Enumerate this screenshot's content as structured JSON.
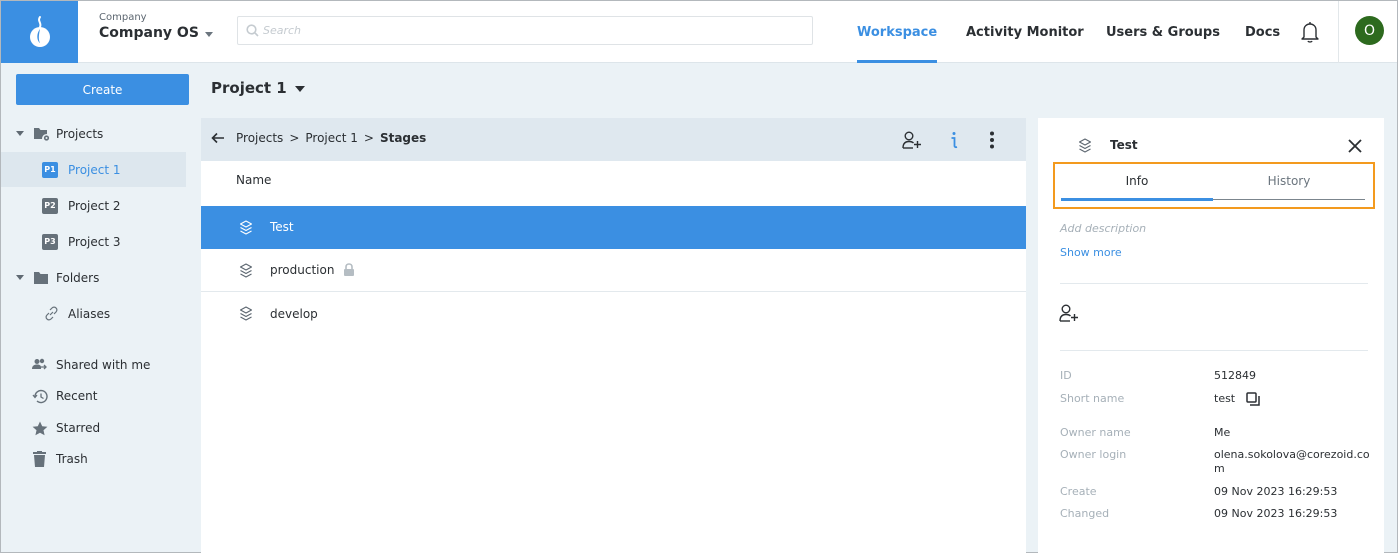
{
  "topbar": {
    "company_label": "Company",
    "company_name": "Company OS",
    "search_placeholder": "Search",
    "search_value": "",
    "nav": [
      {
        "label": "Workspace",
        "active": true
      },
      {
        "label": "Activity Monitor",
        "active": false
      },
      {
        "label": "Users & Groups",
        "active": false
      },
      {
        "label": "Docs",
        "active": false
      }
    ],
    "avatar_initial": "O",
    "colors": {
      "accent": "#3b8fe2",
      "avatar": "#2d6a1e"
    }
  },
  "sidebar": {
    "create_label": "Create",
    "projects_label": "Projects",
    "projects": [
      {
        "badge": "P1",
        "label": "Project 1",
        "selected": true
      },
      {
        "badge": "P2",
        "label": "Project 2",
        "selected": false
      },
      {
        "badge": "P3",
        "label": "Project 3",
        "selected": false
      }
    ],
    "folders_label": "Folders",
    "aliases_label": "Aliases",
    "shared_label": "Shared with me",
    "recent_label": "Recent",
    "starred_label": "Starred",
    "trash_label": "Trash"
  },
  "main": {
    "project_title": "Project 1",
    "breadcrumb": [
      "Projects",
      "Project 1",
      "Stages"
    ],
    "breadcrumb_separator": ">",
    "column_name": "Name",
    "rows": [
      {
        "label": "Test",
        "selected": true,
        "locked": false
      },
      {
        "label": "production",
        "selected": false,
        "locked": true
      },
      {
        "label": "develop",
        "selected": false,
        "locked": false
      }
    ]
  },
  "details": {
    "title": "Test",
    "tabs": [
      {
        "label": "Info",
        "active": true
      },
      {
        "label": "History",
        "active": false
      }
    ],
    "description_placeholder": "Add description",
    "show_more": "Show more",
    "fields": {
      "id_label": "ID",
      "id_value": "512849",
      "short_name_label": "Short name",
      "short_name_value": "test",
      "owner_name_label": "Owner name",
      "owner_name_value": "Me",
      "owner_login_label": "Owner login",
      "owner_login_value": "olena.sokolova@corezoid.com",
      "create_label": "Create",
      "create_value": "09 Nov 2023 16:29:53",
      "changed_label": "Changed",
      "changed_value": "09 Nov 2023 16:29:53"
    },
    "highlight_color": "#f39a1e"
  }
}
